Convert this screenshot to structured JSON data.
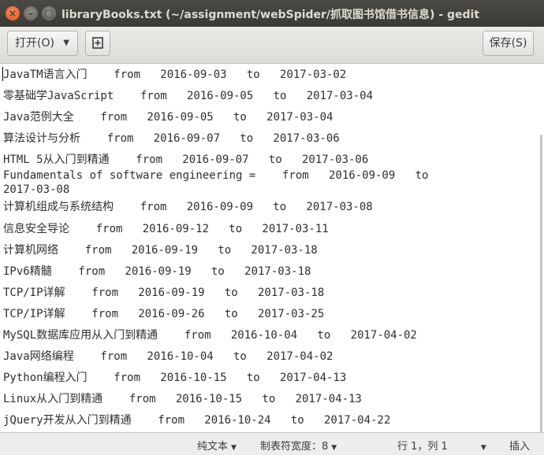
{
  "window": {
    "title": "libraryBooks.txt (~/assignment/webSpider/抓取图书馆借书信息) - gedit",
    "close_glyph": "×",
    "min_glyph": "–",
    "max_glyph": "□"
  },
  "header": {
    "open_label": "打开(O)",
    "open_caret": "▼",
    "new_doc_icon": "new-document-icon",
    "save_label": "保存(S)"
  },
  "document": {
    "lines": [
      "JavaTM语言入门    from   2016-09-03   to   2017-03-02",
      "零基础学JavaScript    from   2016-09-05   to   2017-03-04",
      "Java范例大全    from   2016-09-05   to   2017-03-04",
      "算法设计与分析    from   2016-09-07   to   2017-03-06",
      "HTML 5从入门到精通    from   2016-09-07   to   2017-03-06",
      "Fundamentals of software engineering =    from   2016-09-09   to",
      "2017-03-08",
      "计算机组成与系统结构    from   2016-09-09   to   2017-03-08",
      "信息安全导论    from   2016-09-12   to   2017-03-11",
      "计算机网络    from   2016-09-19   to   2017-03-18",
      "IPv6精髓    from   2016-09-19   to   2017-03-18",
      "TCP/IP详解    from   2016-09-19   to   2017-03-18",
      "TCP/IP详解    from   2016-09-26   to   2017-03-25",
      "MySQL数据库应用从入门到精通    from   2016-10-04   to   2017-04-02",
      "Java网络编程    from   2016-10-04   to   2017-04-02",
      "Python编程入门    from   2016-10-15   to   2017-04-13",
      "Linux从入门到精通    from   2016-10-15   to   2017-04-13",
      "jQuery开发从入门到精通    from   2016-10-24   to   2017-04-22"
    ]
  },
  "statusbar": {
    "syntax": "纯文本",
    "tab_width": "制表符宽度：8",
    "position": "行 1，列 1",
    "mode": "插入",
    "caret": "▼"
  }
}
